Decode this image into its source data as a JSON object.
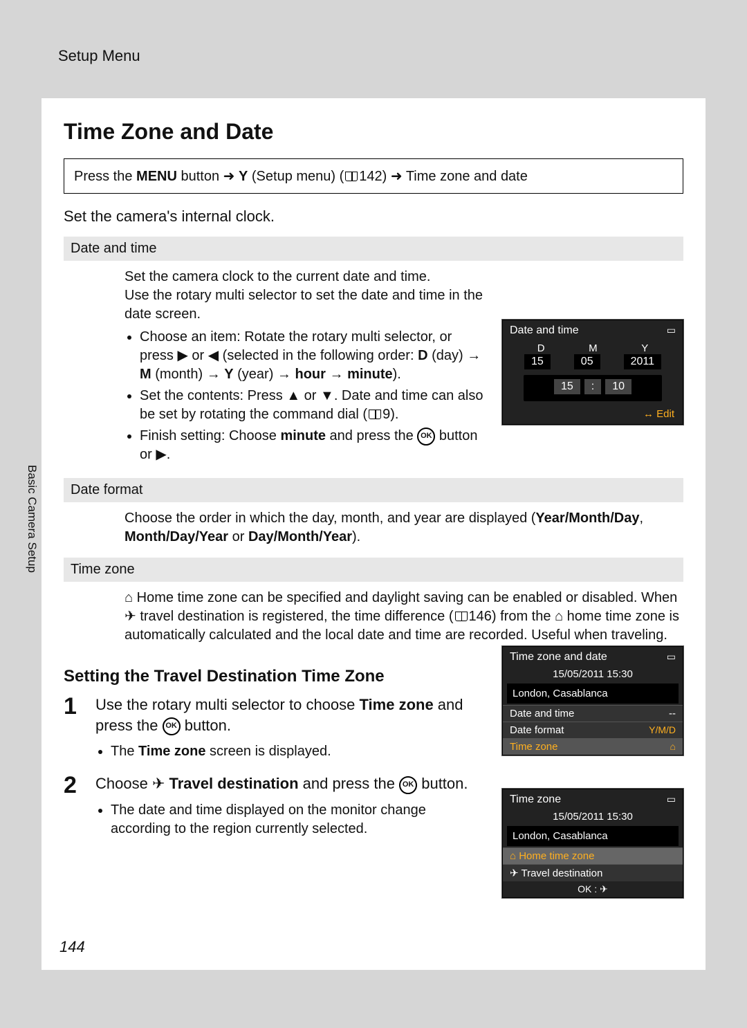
{
  "breadcrumb": "Setup Menu",
  "side_caption": "Basic Camera Setup",
  "page_number": "144",
  "title": "Time Zone and Date",
  "nav": {
    "prefix": "Press the ",
    "menu": "MENU",
    "mid1": " button ➜ ",
    "wrench": "🔧",
    "mid2": " (Setup menu) (",
    "ref1": "142",
    "mid3": ") ➜ ",
    "tail": "Time zone and date"
  },
  "intro": "Set the camera's internal clock.",
  "sec1": {
    "header": "Date and time",
    "p1": "Set the camera clock to the current date and time.",
    "p2": "Use the rotary multi selector to set the date and time in the date screen.",
    "b1a": "Choose an item: Rotate the rotary multi selector, or press ▶ or ◀ (selected in the following order: ",
    "b1b": " (day) → ",
    "b1c": " (month) → ",
    "b1d": " (year) → ",
    "b1e": " → ",
    "b1f": ").",
    "d": "D",
    "m": "M",
    "y": "Y",
    "hour": "hour",
    "minute": "minute",
    "b2a": "Set the contents: Press ▲ or ▼. Date and time can also be set by rotating the command dial (",
    "b2ref": "9",
    "b2b": ").",
    "b3a": "Finish setting: Choose ",
    "b3m": "minute",
    "b3b": " and press the ",
    "b3c": " button or ▶."
  },
  "sec2": {
    "header": "Date format",
    "p1a": "Choose the order in which the day, month, and year are displayed (",
    "o1": "Year/Month/Day",
    "sep1": ", ",
    "o2": "Month/Day/Year",
    "sep2": " or ",
    "o3": "Day/Month/Year",
    "p1b": ")."
  },
  "sec3": {
    "header": "Time zone",
    "p1a": "⌂ Home time zone can be specified and daylight saving can be enabled or disabled. When ✈ travel destination is registered, the time difference (",
    "ref": "146",
    "p1b": ") from the ⌂ home time zone is automatically calculated and the local date and time are recorded. Useful when traveling."
  },
  "h2": "Setting the Travel Destination Time Zone",
  "step1": {
    "n": "1",
    "t1": "Use the rotary multi selector to choose ",
    "tz": "Time zone",
    "t2": " and press the ",
    "t3": " button.",
    "b1a": "The ",
    "b1tz": "Time zone",
    "b1b": " screen is displayed."
  },
  "step2": {
    "n": "2",
    "t1": "Choose ✈ ",
    "td": "Travel destination",
    "t2": " and press the ",
    "t3": " button.",
    "b1": "The date and time displayed on the monitor change according to the region currently selected."
  },
  "lcd1": {
    "title": "Date and time",
    "d": "D",
    "m": "M",
    "y": "Y",
    "dv": "15",
    "mv": "05",
    "yv": "2011",
    "hv": "15",
    "minv": "10",
    "edit": "Edit"
  },
  "lcd2": {
    "title": "Time zone and date",
    "dt": "15/05/2011  15:30",
    "loc": "London, Casablanca",
    "m1": "Date and time",
    "m1v": "--",
    "m2": "Date format",
    "m2v": "Y/M/D",
    "m3": "Time zone",
    "m3v": "⌂"
  },
  "lcd3": {
    "title": "Time zone",
    "dt": "15/05/2011  15:30",
    "loc": "London, Casablanca",
    "m1": "⌂ Home time zone",
    "m2": "✈ Travel destination",
    "foot": "OK : ✈"
  }
}
